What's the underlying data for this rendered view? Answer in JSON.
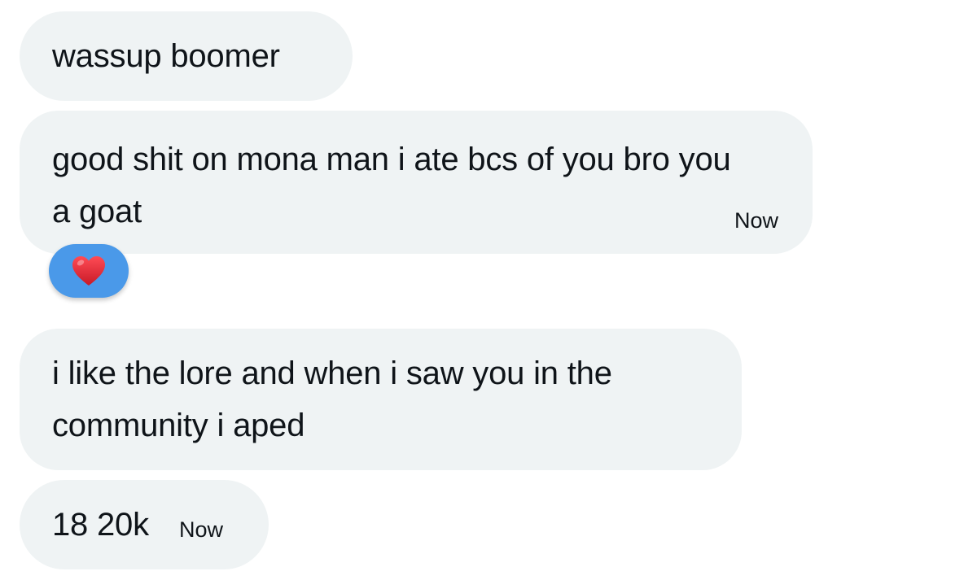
{
  "messages": [
    {
      "text": "wassup boomer"
    },
    {
      "text": "good shit on mona man i ate bcs of you bro you a goat",
      "time": "Now"
    },
    {
      "text": "i like the lore and when i saw you in the community i aped"
    },
    {
      "text": "18 20k",
      "time": "Now"
    }
  ],
  "reaction": {
    "icon": "red-heart-icon",
    "color": "#4a99e9",
    "heart_color": "#e0202e"
  },
  "colors": {
    "bubble": "#eff3f4",
    "text": "#0f1419",
    "background": "#ffffff"
  }
}
